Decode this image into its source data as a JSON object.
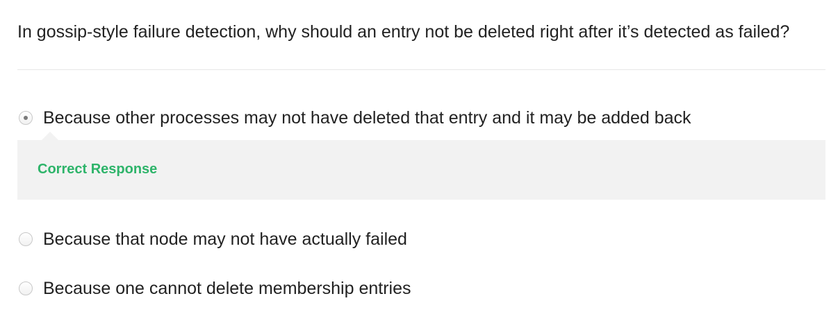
{
  "question": {
    "text": "In gossip-style failure detection, why should an entry not be deleted right after it’s detected as failed?"
  },
  "options": [
    {
      "label": "Because other processes may not have deleted that entry and it may be added back",
      "selected": true
    },
    {
      "label": "Because that node may not have actually failed",
      "selected": false
    },
    {
      "label": "Because one cannot delete membership entries",
      "selected": false
    }
  ],
  "feedback": {
    "status": "Correct Response",
    "status_color": "#2eb46a"
  }
}
